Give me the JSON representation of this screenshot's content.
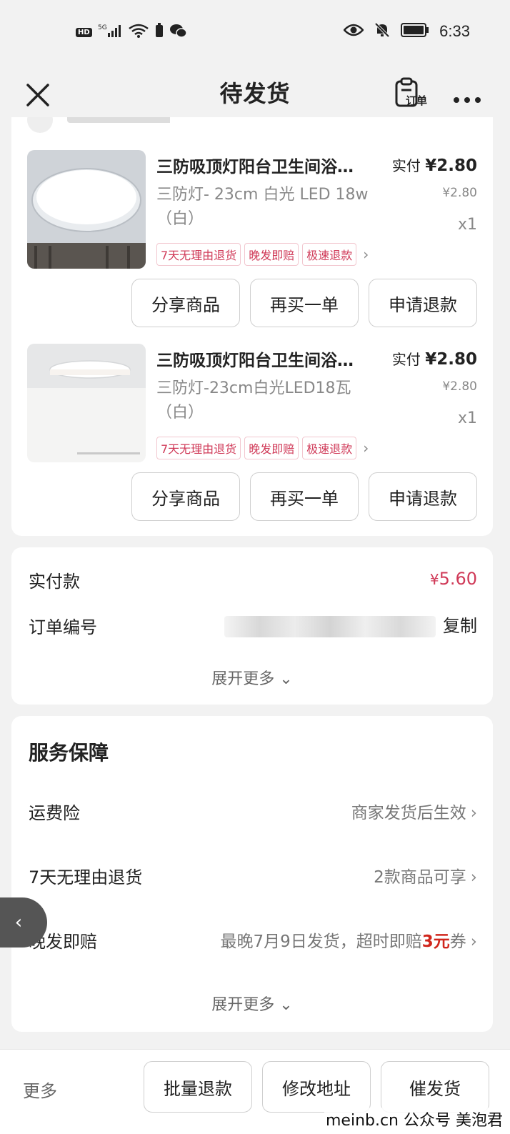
{
  "status_bar": {
    "hd": "HD",
    "network": "5G",
    "time": "6:33"
  },
  "header": {
    "title": "待发货",
    "order_label": "订单"
  },
  "products": [
    {
      "title": "三防吸顶灯阳台卫生间浴…",
      "paid_prefix": "实付",
      "paid_amount": "¥2.80",
      "spec": "三防灯- 23cm 白光 LED 18w（白）",
      "unit_price": "¥2.80",
      "qty": "x1",
      "tags": [
        "7天无理由退货",
        "晚发即赔",
        "极速退款"
      ],
      "buttons": [
        "分享商品",
        "再买一单",
        "申请退款"
      ]
    },
    {
      "title": "三防吸顶灯阳台卫生间浴…",
      "paid_prefix": "实付",
      "paid_amount": "¥2.80",
      "spec": "三防灯-23cm白光LED18瓦（白）",
      "unit_price": "¥2.80",
      "qty": "x1",
      "tags": [
        "7天无理由退货",
        "晚发即赔",
        "极速退款"
      ],
      "buttons": [
        "分享商品",
        "再买一单",
        "申请退款"
      ]
    }
  ],
  "payment": {
    "label": "实付款",
    "currency": "¥",
    "amount": "5.60",
    "order_no_label": "订单编号",
    "copy_label": "复制",
    "expand_label": "展开更多"
  },
  "service": {
    "title": "服务保障",
    "rows": [
      {
        "label": "运费险",
        "value": "商家发货后生效"
      },
      {
        "label": "7天无理由退货",
        "value": "2款商品可享"
      },
      {
        "label": "晚发即赔",
        "value_prefix": "最晚7月9日发货，超时即赔",
        "value_highlight": "3元",
        "value_suffix": "券"
      }
    ],
    "expand_label": "展开更多"
  },
  "bottom_bar": {
    "more": "更多",
    "buttons": [
      "批量退款",
      "修改地址",
      "催发货"
    ]
  },
  "watermark": "meinb.cn 公众号 美泡君",
  "colors": {
    "accent_red": "#d03a58",
    "highlight_red": "#d0261c",
    "background": "#f2f2f2"
  }
}
